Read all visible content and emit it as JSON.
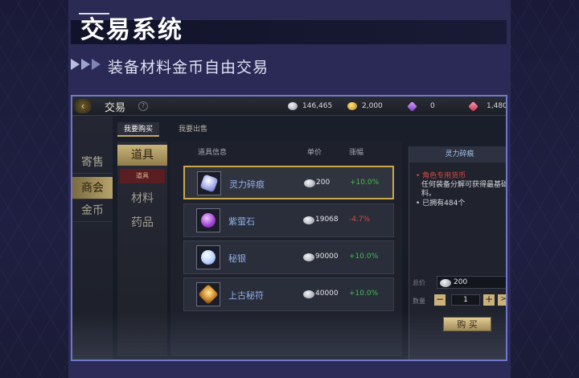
{
  "page": {
    "title": "交易系统",
    "subtitle": "装备材料金币自由交易"
  },
  "colors": {
    "accent": "#c9a84a",
    "panel": "#2b2a55",
    "frame": "#6f77c8",
    "up": "#3fbf4a",
    "down": "#d44a3f",
    "item_name": "#8fb0e8"
  },
  "game": {
    "window_title": "交易",
    "currencies": [
      {
        "icon": "silver-coin-icon",
        "value": "146,465"
      },
      {
        "icon": "gold-coin-icon",
        "value": "2,000"
      },
      {
        "icon": "purple-gem-icon",
        "value": "0"
      },
      {
        "icon": "red-gem-icon",
        "value": "1,480"
      }
    ],
    "left_tabs": [
      "寄售",
      "商会",
      "金币"
    ],
    "active_left_tab": "商会",
    "sub_tabs": [
      "我要购买",
      "我要出售"
    ],
    "categories": [
      "道具",
      "材料",
      "药品"
    ],
    "subcategory": "道具",
    "list_headers": {
      "info": "道具信息",
      "price": "单价",
      "change": "涨幅"
    },
    "items": [
      {
        "name": "灵力碎痕",
        "price": "200",
        "change": "+10.0%",
        "icon": "spirit-shard-icon",
        "selected": true
      },
      {
        "name": "紫萤石",
        "price": "19068",
        "change": "-4.7%",
        "icon": "purple-fluorite-icon",
        "selected": false
      },
      {
        "name": "秘银",
        "price": "90000",
        "change": "+10.0%",
        "icon": "mithril-icon",
        "selected": false
      },
      {
        "name": "上古秘符",
        "price": "40000",
        "change": "+10.0%",
        "icon": "ancient-rune-icon",
        "selected": false
      }
    ],
    "detail": {
      "title": "灵力碎痕",
      "tag": "角色专用货币",
      "desc_1": "任何装备分解可获得最基础",
      "desc_2": "料。",
      "owned": "已拥有484个",
      "total_label": "总价",
      "total_value": "200",
      "qty_label": "数量",
      "qty_value": "1",
      "buy_label": "购 买"
    }
  }
}
